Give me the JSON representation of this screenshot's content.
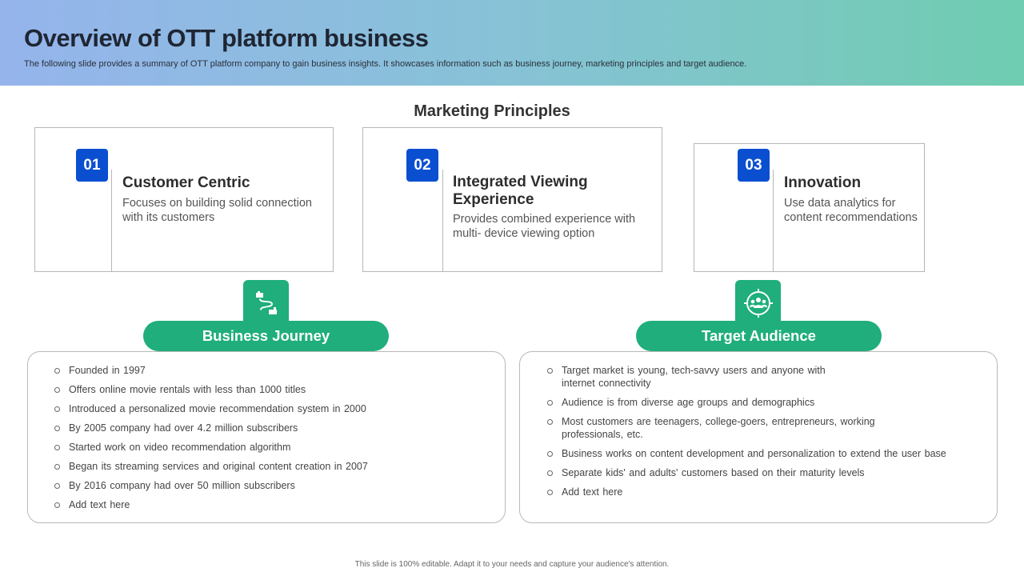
{
  "header": {
    "title": "Overview of OTT  platform business",
    "subtitle": "The following slide provides a summary of OTT platform company to gain business insights. It showcases information such as business journey, marketing principles and target audience."
  },
  "marketing": {
    "heading": "Marketing Principles",
    "cards": [
      {
        "number": "01",
        "title": "Customer Centric",
        "desc": "Focuses on building solid connection with its customers"
      },
      {
        "number": "02",
        "title": "Integrated Viewing Experience",
        "desc": "Provides combined experience with multi- device viewing option"
      },
      {
        "number": "03",
        "title": "Innovation",
        "desc": "Use data analytics for content recommendations"
      }
    ]
  },
  "business_journey": {
    "label": "Business Journey",
    "icon": "journey-path-icon",
    "items": [
      "Founded in 1997",
      "Offers online movie rentals with less than 1000 titles",
      "Introduced a personalized movie recommendation system in 2000",
      "By 2005 company had over 4.2 million subscribers",
      "Started work on video recommendation algorithm",
      "Began its streaming services and original content creation in 2007",
      "By 2016 company had over 50 million subscribers",
      "Add text here"
    ]
  },
  "target_audience": {
    "label": "Target Audience",
    "icon": "audience-target-icon",
    "items": [
      "Target market is young, tech-savvy users and anyone with internet connectivity",
      "Audience is from diverse age groups and demographics",
      "Most customers are teenagers, college-goers, entrepreneurs, working professionals, etc.",
      "Business works on content development and personalization to extend the user base",
      "Separate kids' and adults' customers based on their maturity levels",
      "Add text here"
    ]
  },
  "footer": {
    "note": "This slide is 100% editable. Adapt it to your needs and capture your audience's attention."
  },
  "colors": {
    "accent_green": "#1fae7c",
    "badge_blue": "#0b4fd1"
  }
}
